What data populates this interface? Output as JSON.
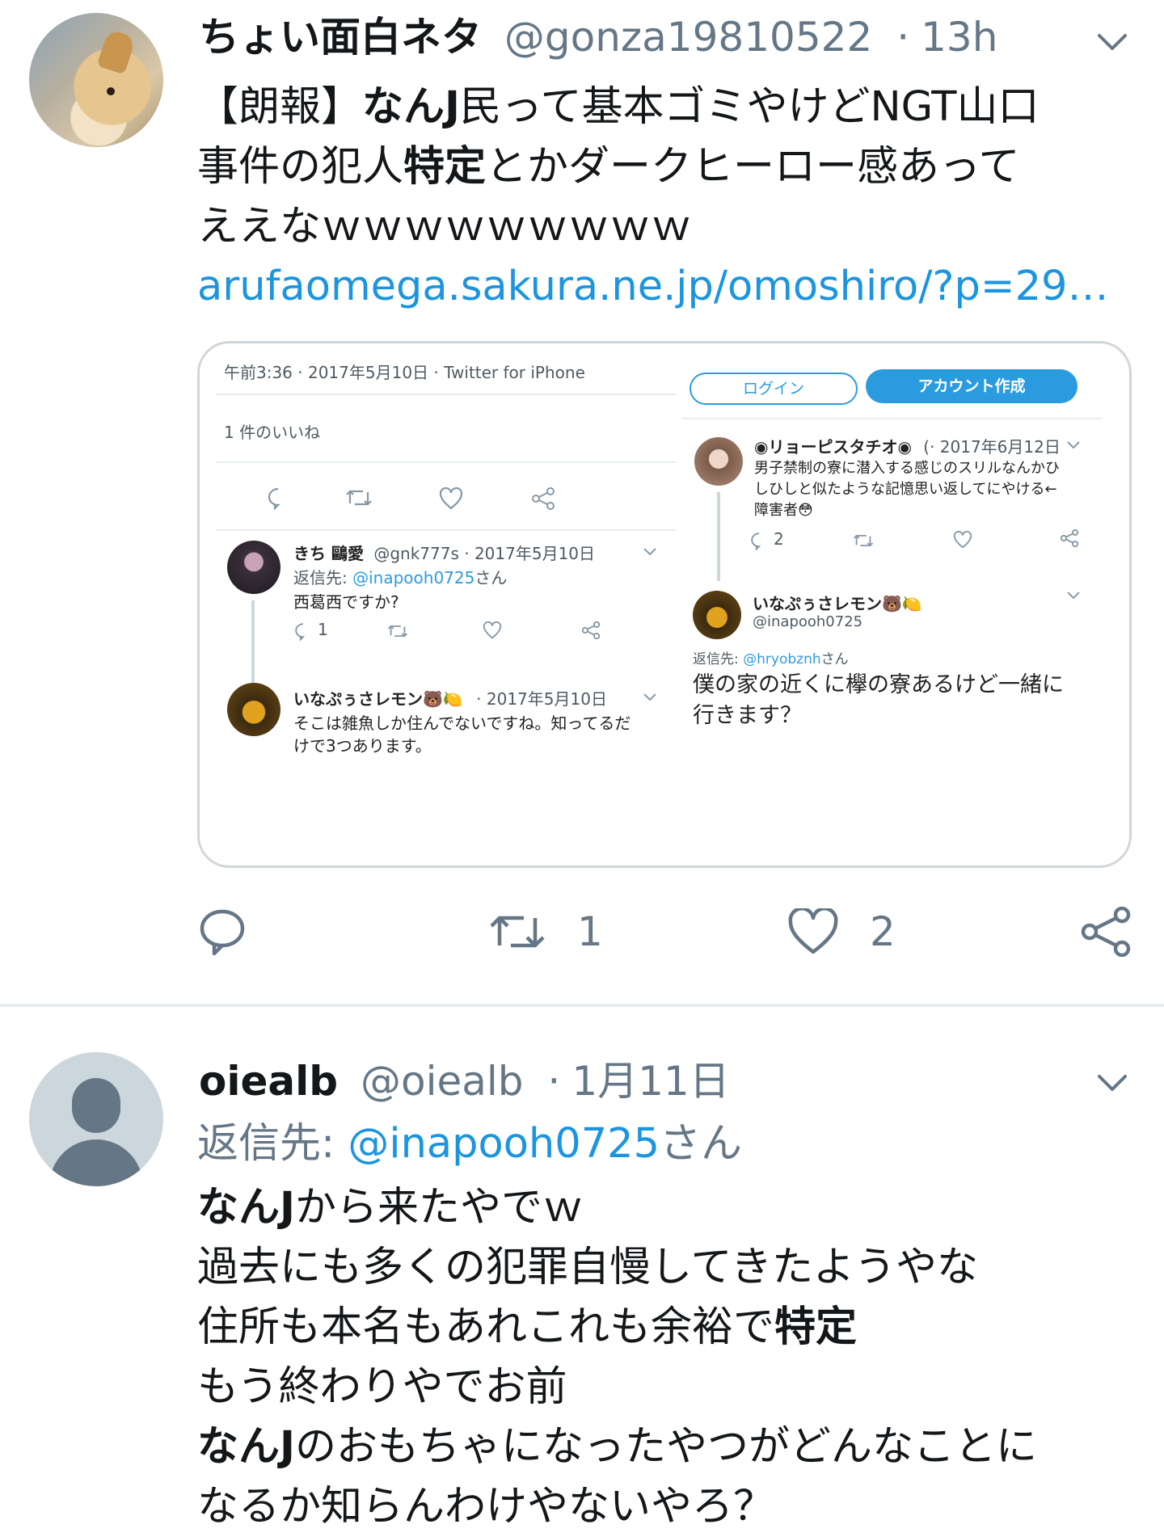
{
  "tweet1": {
    "display_name": "ちょい面白ネタ",
    "handle": "@gonza19810522",
    "separator": "·",
    "time": "13h",
    "avatar_icon": "dog-avatar",
    "text": {
      "part1": "【朗報】",
      "part2_bold": "なんJ",
      "part3": "民って基本ゴミやけどNGT山口",
      "line2_part1": "事件の犯人",
      "line2_bold": "特定",
      "line2_part2": "とかダークヒーロー感あって",
      "line3": "ええなｗｗｗｗｗｗｗｗｗ"
    },
    "link": "arufaomega.sakura.ne.jp/omoshiro/?p=29…",
    "media": {
      "left": {
        "meta": "午前3:36 · 2017年5月10日 · Twitter for iPhone",
        "likes": "1 件のいいね",
        "reply1": {
          "name": "きち 鷗愛",
          "handle": "@gnk777s · 2017年5月10日",
          "reply_to_label": "返信先:",
          "reply_to_handle": "@inapooh0725",
          "reply_to_suffix": "さん",
          "text": "西葛西ですか?",
          "reply_count": "1"
        },
        "reply2": {
          "name": "いなぷぅさレモン🐻🍋",
          "date": "· 2017年5月10日",
          "text_line1": "そこは雑魚しか住んでないですね。知ってるだ",
          "text_line2": "けで3つあります。"
        }
      },
      "right": {
        "login_button": "ログイン",
        "signup_button": "アカウント作成",
        "tweet1": {
          "name": "◉リョーピスタチオ◉",
          "date": "(· 2017年6月12日",
          "line1": "男子禁制の寮に潜入する感じのスリルなんかひ",
          "line2": "しひしと似たような記憶思い返してにやける←",
          "line3": "障害者😳",
          "reply_count": "2"
        },
        "tweet2": {
          "name": "いなぷぅさレモン🐻🍋",
          "handle": "@inapooh0725",
          "reply_to_label": "返信先:",
          "reply_to_handle": "@hryobznh",
          "reply_to_suffix": "さん",
          "line1": "僕の家の近くに欅の寮あるけど一緒に",
          "line2": "行きます？"
        }
      }
    },
    "actions": {
      "reply_icon": "reply-icon",
      "retweet_icon": "retweet-icon",
      "retweet_count": "1",
      "like_icon": "heart-icon",
      "like_count": "2",
      "share_icon": "share-icon"
    }
  },
  "tweet2": {
    "display_name": "oiealb",
    "handle": "@oiealb",
    "separator": "·",
    "time": "1月11日",
    "reply_to_label": "返信先:",
    "reply_to_handle": "@inapooh0725",
    "reply_to_suffix": "さん",
    "lines": {
      "l1_bold": "なんJ",
      "l1": "から来たやでｗ",
      "l2": "過去にも多くの犯罪自慢してきたようやな",
      "l3": "住所も本名もあれこれも余裕で",
      "l3_bold": "特定",
      "l4": "もう終わりやでお前",
      "l5_bold": "なんJ",
      "l5": "のおもちゃになったやつがどんなことに",
      "l6": "なるか知らんわけやないやろ？"
    }
  }
}
